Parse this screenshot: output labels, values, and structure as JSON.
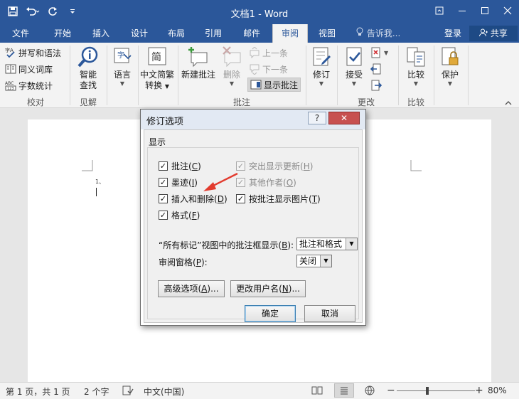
{
  "window": {
    "title": "文档1 - Word",
    "controls": [
      "restore-ribbon-icon",
      "minimize-icon",
      "maximize-icon",
      "close-icon"
    ]
  },
  "tabs": [
    "文件",
    "开始",
    "插入",
    "设计",
    "布局",
    "引用",
    "邮件",
    "审阅",
    "视图"
  ],
  "active_tab": "审阅",
  "tell_me": "告诉我...",
  "login": "登录",
  "share": "共享",
  "ribbon": {
    "proofing": {
      "items": [
        "拼写和语法",
        "同义词库",
        "字数统计"
      ],
      "label": "校对"
    },
    "insights": {
      "smart_lookup_line1": "智能",
      "smart_lookup_line2": "查找",
      "label": "见解"
    },
    "language": {
      "label": "语言"
    },
    "chinese": {
      "line1": "中文简繁",
      "line2": "转换"
    },
    "comments": {
      "new": "新建批注",
      "delete": "删除",
      "prev": "上一条",
      "next": "下一条",
      "show": "显示批注",
      "label": "批注"
    },
    "tracking": {
      "label": "修订"
    },
    "changes": {
      "accept": "接受",
      "label": "更改"
    },
    "compare": {
      "btn": "比较",
      "label": "比较"
    },
    "protect": {
      "btn": "保护"
    }
  },
  "document": {
    "list_marker": "1、"
  },
  "statusbar": {
    "page": "第 1 页，共 1 页",
    "words": "2 个字",
    "language": "中文(中国)",
    "zoom": "80%",
    "zoom_percent": 80
  },
  "dialog": {
    "title": "修订选项",
    "help": "?",
    "close": "✕",
    "section": "显示",
    "checkboxes": [
      {
        "text": "批注(",
        "key": "C",
        "end": ")",
        "checked": true,
        "enabled": true
      },
      {
        "text": "墨迹(",
        "key": "I",
        "end": ")",
        "checked": true,
        "enabled": true
      },
      {
        "text": "插入和删除(",
        "key": "D",
        "end": ")",
        "checked": true,
        "enabled": true
      },
      {
        "text": "格式(",
        "key": "F",
        "end": ")",
        "checked": true,
        "enabled": true
      },
      {
        "text": "突出显示更新(",
        "key": "H",
        "end": ")",
        "checked": true,
        "enabled": false
      },
      {
        "text": "其他作者(",
        "key": "O",
        "end": ")",
        "checked": true,
        "enabled": false
      },
      {
        "text": "按批注显示图片(",
        "key": "T",
        "end": ")",
        "checked": true,
        "enabled": true
      }
    ],
    "balloons_label": "“所有标记”视图中的批注框显示(",
    "balloons_key": "B",
    "balloons_end": "):",
    "balloons_value": "批注和格式",
    "pane_label": "审阅窗格(",
    "pane_key": "P",
    "pane_end": "):",
    "pane_value": "关闭",
    "advanced_btn": "高级选项(",
    "advanced_key": "A",
    "advanced_end": ")...",
    "username_btn": "更改用户名(",
    "username_key": "N",
    "username_end": ")...",
    "ok": "确定",
    "cancel": "取消"
  },
  "colors": {
    "accent": "#2b579a",
    "arrow": "#e23b2e"
  }
}
